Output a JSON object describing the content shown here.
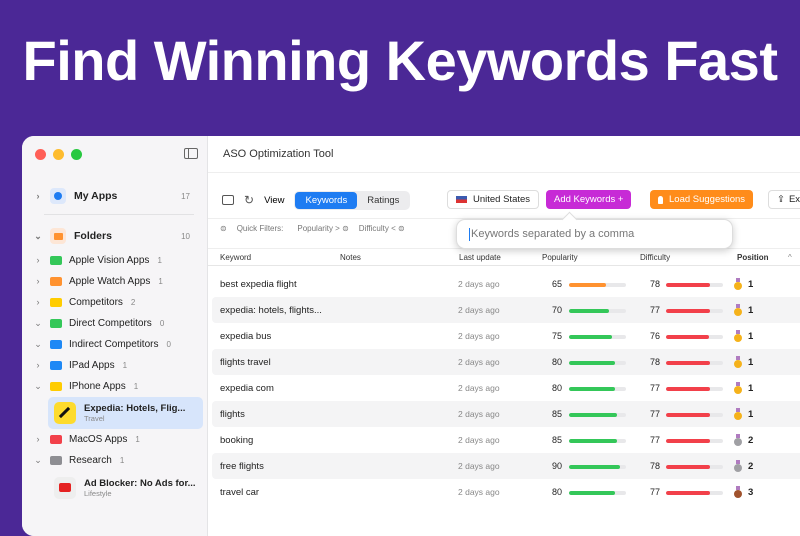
{
  "headline": "Find Winning Keywords Fast",
  "window_title": "ASO Optimization Tool",
  "sidebar": {
    "my_apps": {
      "label": "My Apps",
      "count": "17"
    },
    "folders": {
      "label": "Folders",
      "count": "10"
    },
    "items": [
      {
        "label": "Apple Vision Apps",
        "count": "1",
        "color": "#34c759",
        "chev": "›"
      },
      {
        "label": "Apple Watch Apps",
        "count": "1",
        "color": "#ff9230",
        "chev": "›"
      },
      {
        "label": "Competitors",
        "count": "2",
        "color": "#ffcc00",
        "chev": "›"
      },
      {
        "label": "Direct Competitors",
        "count": "0",
        "color": "#34c759",
        "chev": "⌄"
      },
      {
        "label": "Indirect Competitors",
        "count": "0",
        "color": "#1e88f5",
        "chev": "⌄"
      },
      {
        "label": "IPad Apps",
        "count": "1",
        "color": "#1e88f5",
        "chev": "›"
      },
      {
        "label": "IPhone Apps",
        "count": "1",
        "color": "#ffcc00",
        "chev": "⌄"
      }
    ],
    "selected_app": {
      "name": "Expedia: Hotels, Flig...",
      "category": "Travel"
    },
    "items2": [
      {
        "label": "MacOS Apps",
        "count": "1",
        "color": "#f2404a",
        "chev": "›"
      },
      {
        "label": "Research",
        "count": "1",
        "color": "#8e8e93",
        "chev": "⌄"
      }
    ],
    "research_app": {
      "name": "Ad Blocker: No Ads for...",
      "category": "Lifestyle"
    }
  },
  "toolbar": {
    "view_label": "View",
    "tabs": [
      "Keywords",
      "Ratings"
    ],
    "country": "United States",
    "add_keywords": "Add Keywords  +",
    "load_suggestions": "Load Suggestions",
    "export": "Exp"
  },
  "filters": {
    "label": "Quick Filters:",
    "popularity": "Popularity >",
    "difficulty": "Difficulty <"
  },
  "popover": {
    "placeholder": "Keywords separated by a comma"
  },
  "columns": [
    "Keyword",
    "Notes",
    "Last update",
    "Popularity",
    "Difficulty",
    "Position"
  ],
  "colors": {
    "accent": "#1e7cf2",
    "add": "#c72ad6",
    "load": "#ff8c1a",
    "green": "#34c759",
    "orange": "#ff9230",
    "red": "#f2404a"
  },
  "rows": [
    {
      "keyword": "best expedia flight",
      "updated": "2 days ago",
      "popularity": 65,
      "difficulty": 78,
      "position": "1",
      "medal": "gold"
    },
    {
      "keyword": "expedia: hotels, flights...",
      "updated": "2 days ago",
      "popularity": 70,
      "difficulty": 77,
      "position": "1",
      "medal": "gold"
    },
    {
      "keyword": "expedia bus",
      "updated": "2 days ago",
      "popularity": 75,
      "difficulty": 76,
      "position": "1",
      "medal": "gold"
    },
    {
      "keyword": "flights travel",
      "updated": "2 days ago",
      "popularity": 80,
      "difficulty": 78,
      "position": "1",
      "medal": "gold"
    },
    {
      "keyword": "expedia com",
      "updated": "2 days ago",
      "popularity": 80,
      "difficulty": 77,
      "position": "1",
      "medal": "gold"
    },
    {
      "keyword": "flights",
      "updated": "2 days ago",
      "popularity": 85,
      "difficulty": 77,
      "position": "1",
      "medal": "gold"
    },
    {
      "keyword": "booking",
      "updated": "2 days ago",
      "popularity": 85,
      "difficulty": 77,
      "position": "2",
      "medal": "silver"
    },
    {
      "keyword": "free flights",
      "updated": "2 days ago",
      "popularity": 90,
      "difficulty": 78,
      "position": "2",
      "medal": "silver"
    },
    {
      "keyword": "travel car",
      "updated": "2 days ago",
      "popularity": 80,
      "difficulty": 77,
      "position": "3",
      "medal": "bronze"
    }
  ]
}
